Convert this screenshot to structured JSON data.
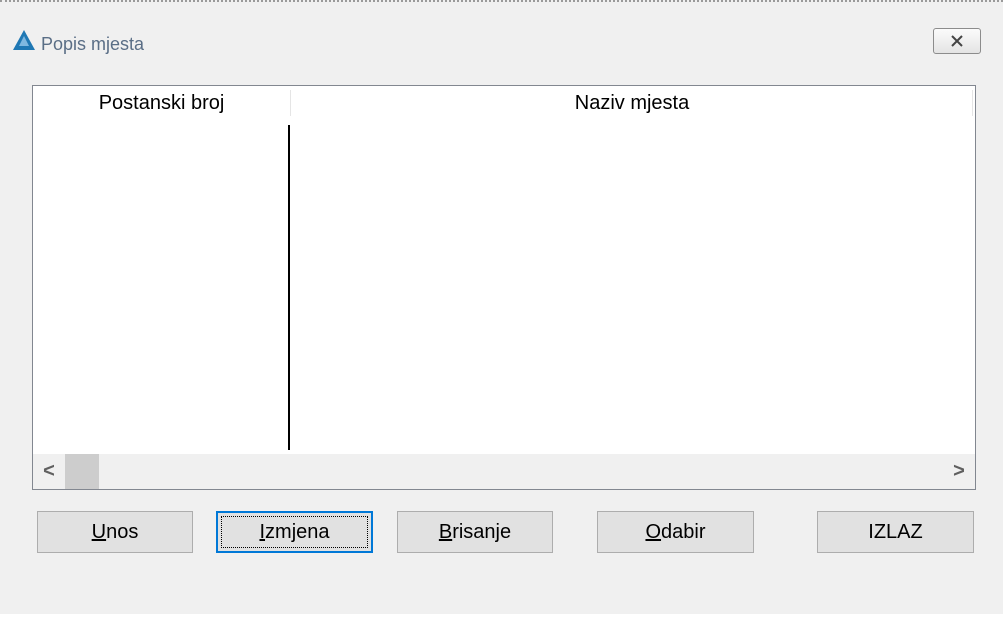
{
  "window": {
    "title": "Popis mjesta"
  },
  "listview": {
    "columns": [
      "Postanski broj",
      "Naziv mjesta"
    ],
    "rows": []
  },
  "buttons": {
    "unos": {
      "accel": "U",
      "rest": "nos"
    },
    "izmjena": {
      "accel": "I",
      "rest": "zmjena"
    },
    "brisanje": {
      "accel": "B",
      "rest": "risanje"
    },
    "odabir": {
      "accel": "O",
      "rest": "dabir"
    },
    "izlaz": {
      "label": "IZLAZ"
    }
  },
  "scrollbar": {
    "left_arrow": "<",
    "right_arrow": ">"
  },
  "colors": {
    "accent": "#0078d7",
    "app_icon": "#1f78b4",
    "title_text": "#5a6e86"
  }
}
